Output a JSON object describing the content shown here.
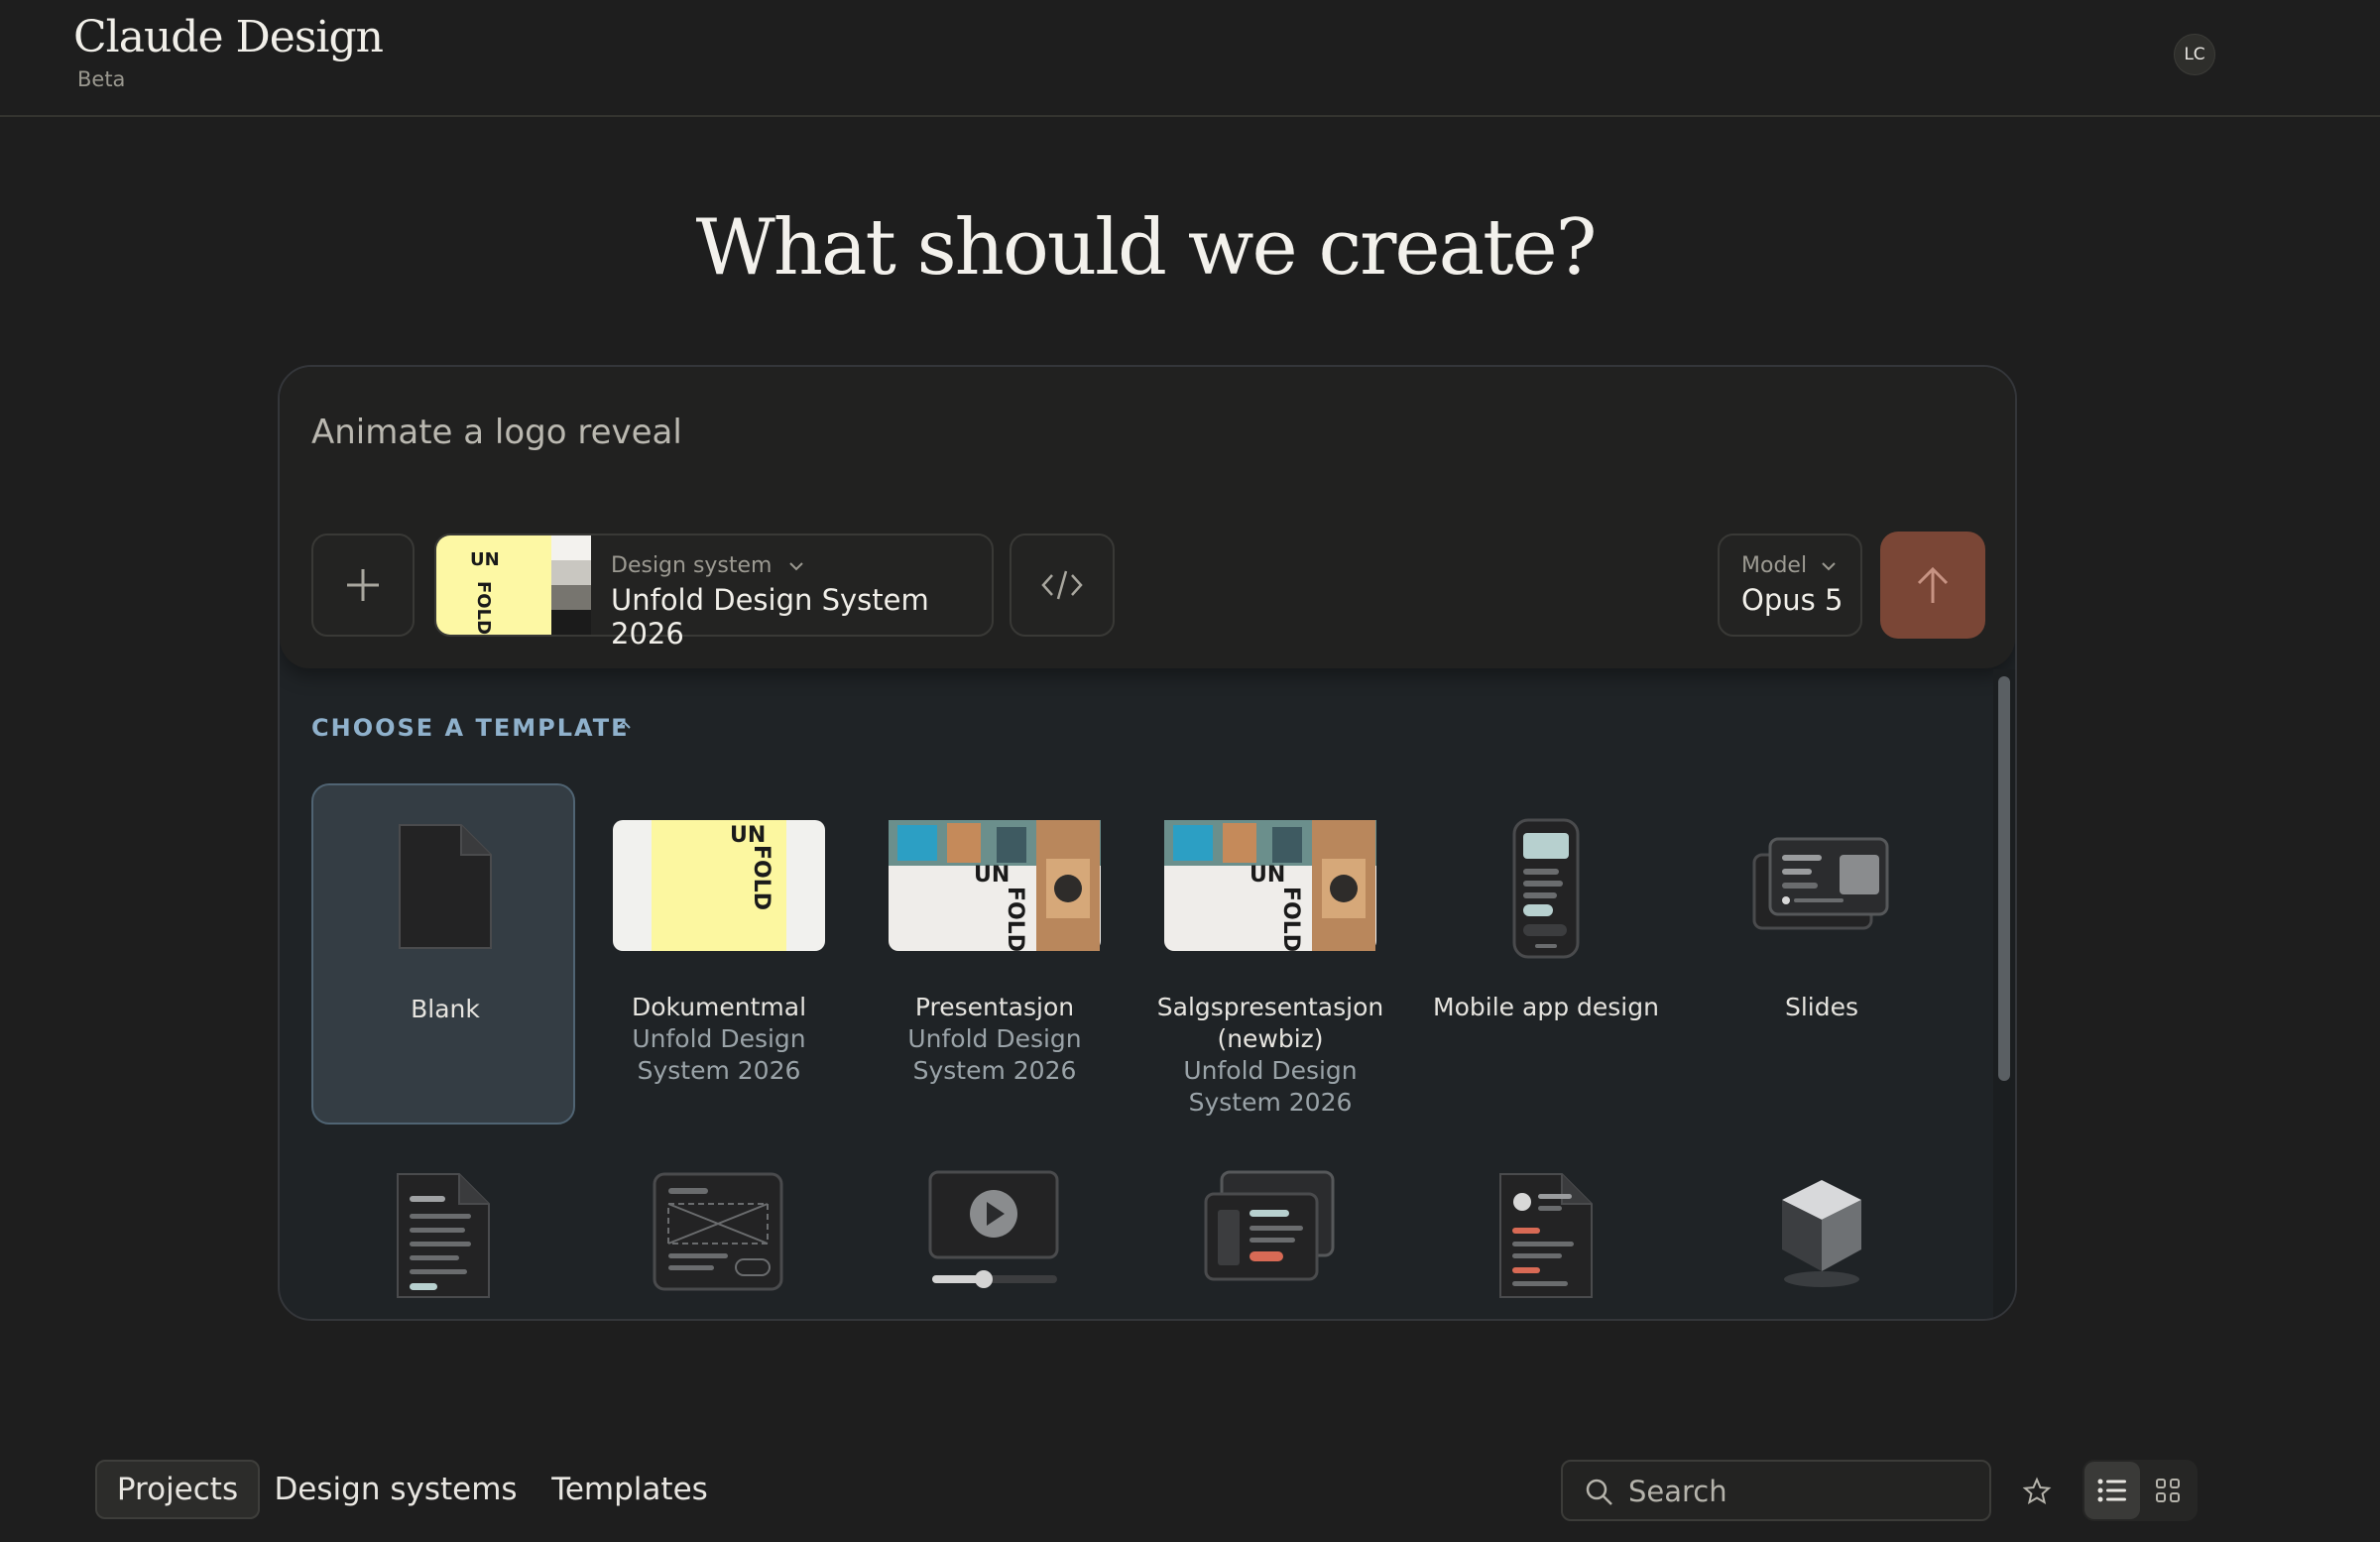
{
  "brand": {
    "title": "Claude Design",
    "subtitle": "Beta"
  },
  "user": {
    "initials": "LC"
  },
  "headline": "What should we create?",
  "composer": {
    "prompt_value": "Animate a logo reveal",
    "add_icon": "plus-icon",
    "design_system": {
      "kicker": "Design system",
      "name": "Unfold Design System 2026",
      "thumb_text_un": "UN",
      "thumb_text_fold": "FOLD"
    },
    "code_icon": "code-icon",
    "model": {
      "kicker": "Model",
      "name": "Opus 5"
    },
    "send_icon": "arrow-up-icon",
    "accent_color": "#7a4636"
  },
  "templates": {
    "heading": "CHOOSE A TEMPLATE",
    "items": [
      {
        "name": "Blank",
        "sub": "",
        "icon": "blank-page-icon"
      },
      {
        "name": "Dokumentmal",
        "sub": "Unfold Design System 2026",
        "icon": "document-template-thumbnail"
      },
      {
        "name": "Presentasjon",
        "sub": "Unfold Design System 2026",
        "icon": "presentation-thumbnail"
      },
      {
        "name": "Salgspresentasjon (newbiz)",
        "sub": "Unfold Design System 2026",
        "icon": "sales-presentation-thumbnail"
      },
      {
        "name": "Mobile app design",
        "sub": "",
        "icon": "mobile-app-icon"
      },
      {
        "name": "Slides",
        "sub": "",
        "icon": "slides-icon"
      }
    ],
    "row2_icons": [
      "document-icon",
      "wireframe-icon",
      "video-icon",
      "cards-icon",
      "report-icon",
      "cube-icon"
    ],
    "thumb_text_un": "UN",
    "thumb_text_fold": "FOLD"
  },
  "bottom_nav": {
    "tabs": [
      {
        "label": "Projects",
        "active": true
      },
      {
        "label": "Design systems",
        "active": false
      },
      {
        "label": "Templates",
        "active": false
      }
    ],
    "search_placeholder": "Search",
    "star_icon": "star-icon",
    "list_view_icon": "list-view-icon",
    "grid_view_icon": "grid-view-icon"
  }
}
